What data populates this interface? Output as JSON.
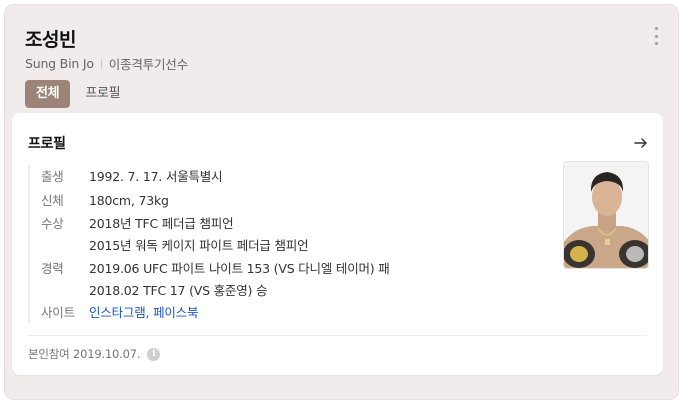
{
  "person": {
    "name": "조성빈",
    "english_name": "Sung Bin Jo",
    "occupation": "이종격투기선수"
  },
  "tabs": [
    {
      "label": "전체",
      "active": true
    },
    {
      "label": "프로필",
      "active": false
    }
  ],
  "profile": {
    "title": "프로필",
    "rows": [
      {
        "label": "출생",
        "values": [
          "1992. 7. 17. 서울특별시"
        ]
      },
      {
        "label": "신체",
        "values": [
          "180cm, 73kg"
        ]
      },
      {
        "label": "수상",
        "values": [
          "2018년 TFC 페더급 챔피언",
          "2015년 워독 케이지 파이트 페더급 챔피언"
        ]
      },
      {
        "label": "경력",
        "values": [
          "2019.06 UFC 파이트 나이트 153 (VS 다니엘 테이머) 패",
          "2018.02 TFC 17 (VS 홍준영) 승"
        ]
      }
    ],
    "site": {
      "label": "사이트",
      "links": [
        "인스타그램",
        "페이스북"
      ],
      "separator": ","
    },
    "footer_text": "본인참여 2019.10.07."
  },
  "colors": {
    "card_bg": "#f1eceb",
    "active_tab": "#9d8479",
    "link": "#1a56c4"
  },
  "icons": [
    "more-vertical-icon",
    "arrow-right-icon",
    "info-icon"
  ]
}
